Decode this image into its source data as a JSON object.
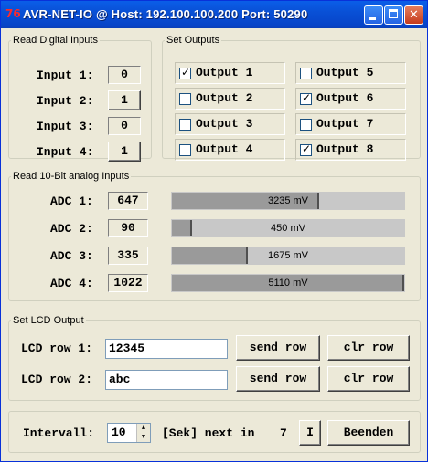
{
  "window": {
    "title": "AVR-NET-IO @ Host: 192.100.100.200 Port: 50290",
    "icon": "app-icon"
  },
  "digital_inputs": {
    "legend": "Read Digital Inputs",
    "items": [
      {
        "label": "Input 1:",
        "value": "0"
      },
      {
        "label": "Input 2:",
        "value": "1"
      },
      {
        "label": "Input 3:",
        "value": "0"
      },
      {
        "label": "Input 4:",
        "value": "1"
      }
    ]
  },
  "outputs": {
    "legend": "Set Outputs",
    "items": [
      {
        "label": "Output 1",
        "checked": true
      },
      {
        "label": "Output 2",
        "checked": false
      },
      {
        "label": "Output 3",
        "checked": false
      },
      {
        "label": "Output 4",
        "checked": false
      },
      {
        "label": "Output 5",
        "checked": false
      },
      {
        "label": "Output 6",
        "checked": true
      },
      {
        "label": "Output 7",
        "checked": false
      },
      {
        "label": "Output 8",
        "checked": true
      }
    ]
  },
  "analog": {
    "legend": "Read 10-Bit analog Inputs",
    "items": [
      {
        "label": "ADC 1:",
        "value": "647",
        "text": "3235 mV",
        "level": 0.632
      },
      {
        "label": "ADC 2:",
        "value": "90",
        "text": "450 mV",
        "level": 0.088
      },
      {
        "label": "ADC 3:",
        "value": "335",
        "text": "1675 mV",
        "level": 0.327
      },
      {
        "label": "ADC 4:",
        "value": "1022",
        "text": "5110 mV",
        "level": 0.999
      }
    ]
  },
  "lcd": {
    "legend": "Set LCD Output",
    "rows": [
      {
        "label": "LCD row 1:",
        "value": "12345",
        "send": "send row",
        "clear": "clr row"
      },
      {
        "label": "LCD row 2:",
        "value": "abc",
        "send": "send row",
        "clear": "clr row"
      }
    ]
  },
  "footer": {
    "interval_label": "Intervall:",
    "interval_value": "10",
    "next_label": "[Sek] next in",
    "countdown": "7",
    "i_button": "I",
    "quit_button": "Beenden"
  }
}
